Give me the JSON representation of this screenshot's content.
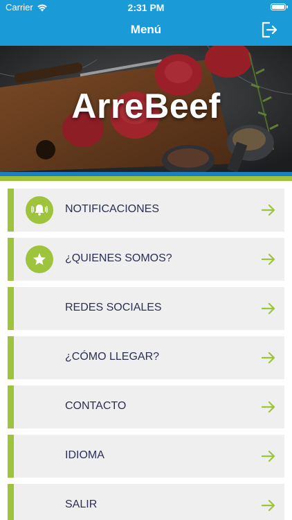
{
  "status_bar": {
    "carrier": "Carrier",
    "time": "2:31 PM"
  },
  "nav": {
    "title": "Menú",
    "logout_icon": "logout-icon"
  },
  "hero": {
    "title": "ArreBeef"
  },
  "colors": {
    "primary_blue": "#1b9ad8",
    "accent_green": "#9dc43c",
    "label_navy": "#2b2f52",
    "item_bg": "#efefef"
  },
  "menu": {
    "items": [
      {
        "label": "NOTIFICACIONES",
        "icon": "bell-icon"
      },
      {
        "label": "¿QUIENES SOMOS?",
        "icon": "star-icon"
      },
      {
        "label": "REDES SOCIALES",
        "icon": ""
      },
      {
        "label": "¿CÓMO LLEGAR?",
        "icon": ""
      },
      {
        "label": "CONTACTO",
        "icon": ""
      },
      {
        "label": "IDIOMA",
        "icon": ""
      },
      {
        "label": "SALIR",
        "icon": ""
      }
    ]
  }
}
